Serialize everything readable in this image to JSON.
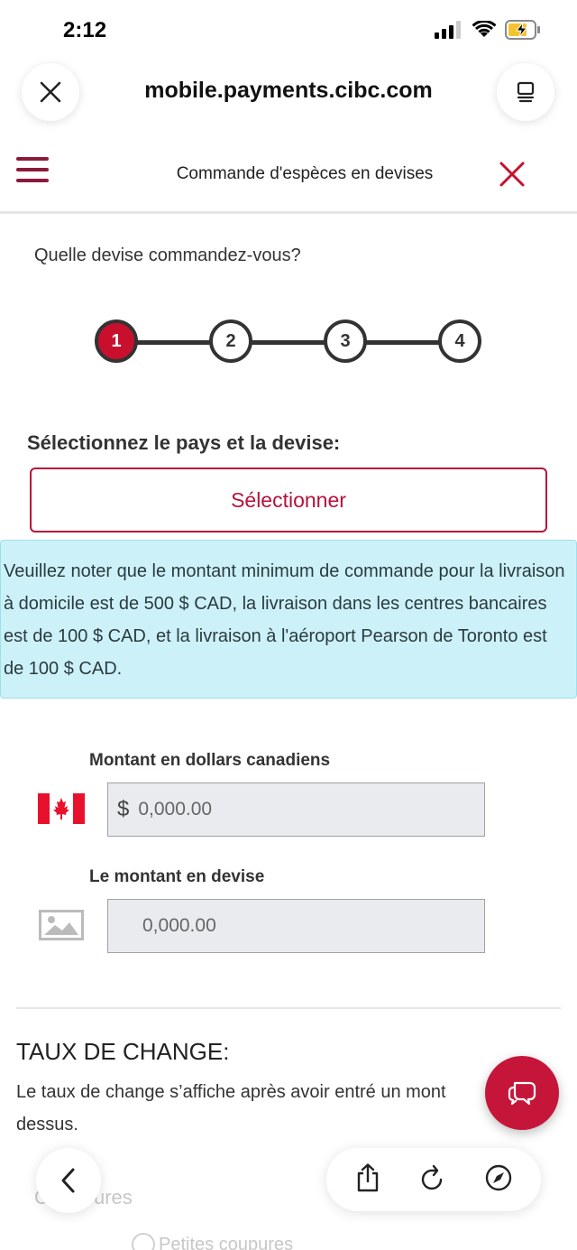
{
  "status_bar": {
    "time": "2:12"
  },
  "browser": {
    "url": "mobile.payments.cibc.com"
  },
  "app_header": {
    "title": "Commande d'espèces en devises"
  },
  "question": "Quelle devise commandez-vous?",
  "stepper": {
    "steps": [
      "1",
      "2",
      "3",
      "4"
    ],
    "active_step": "1"
  },
  "country_select": {
    "label": "Sélectionnez le pays et la devise:",
    "button": "Sélectionner"
  },
  "notice": "Veuillez noter que le montant minimum de commande pour la livraison à domicile est de 500 $ CAD, la livraison dans les centres bancaires est de 100 $ CAD, et la livraison à l'aéroport Pearson de Toronto est de 100 $ CAD.",
  "cad_amount": {
    "label": "Montant en dollars canadiens",
    "currency_symbol": "$",
    "placeholder": "0,000.00"
  },
  "foreign_amount": {
    "label": "Le montant en devise",
    "placeholder": "0,000.00"
  },
  "exchange_rate": {
    "title": "TAUX DE CHANGE:",
    "text": "Le taux de change s’affiche après avoir entré un mont",
    "text_line2": "dessus."
  },
  "partial": {
    "denominations_label": "C",
    "denominations_label_end": "ures",
    "option_small": "Petites coupures"
  },
  "colors": {
    "brand_red": "#c8102e",
    "notice_bg": "#cdf1f8"
  }
}
